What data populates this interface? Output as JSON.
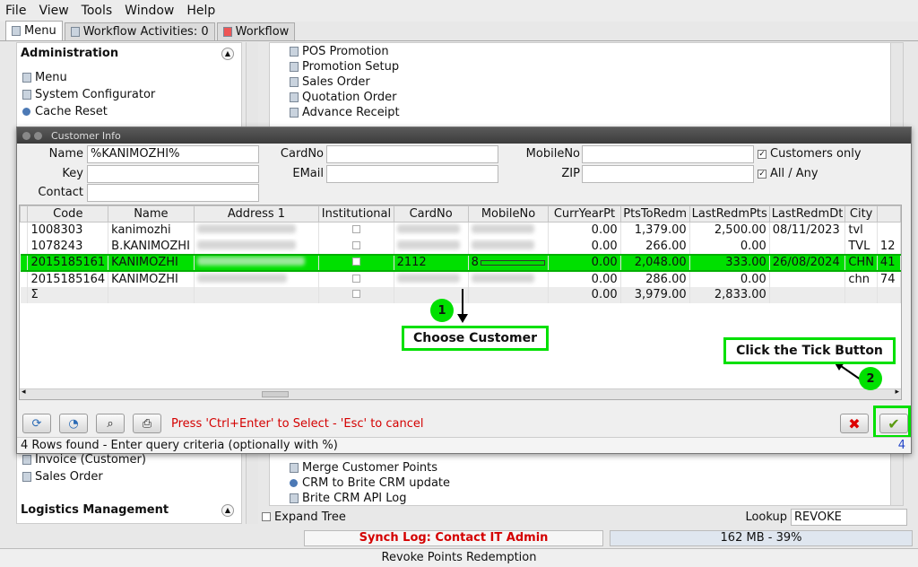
{
  "menubar": {
    "items": [
      "File",
      "View",
      "Tools",
      "Window",
      "Help"
    ]
  },
  "tabs": [
    {
      "label": "Menu"
    },
    {
      "label": "Workflow Activities: 0"
    },
    {
      "label": "Workflow"
    }
  ],
  "left_panel": {
    "admin_title": "Administration",
    "admin_items": [
      "Menu",
      "System Configurator",
      "Cache Reset"
    ],
    "lower_items": [
      "Invoice (Customer)",
      "Sales Order"
    ],
    "logistics_title": "Logistics Management"
  },
  "right_panel": {
    "top_items": [
      "POS Promotion",
      "Promotion Setup",
      "Sales Order",
      "Quotation Order",
      "Advance Receipt"
    ],
    "bottom_items": [
      "Merge Customer Points",
      "CRM to Brite CRM update",
      "Brite CRM API Log"
    ],
    "expand_tree": "Expand Tree",
    "lookup_label": "Lookup",
    "lookup_value": "REVOKE"
  },
  "dialog": {
    "title": "Customer Info",
    "fields": {
      "name_label": "Name",
      "name_value": "%KANIMOZHI%",
      "key_label": "Key",
      "contact_label": "Contact",
      "cardno_label": "CardNo",
      "email_label": "EMail",
      "mobile_label": "MobileNo",
      "zip_label": "ZIP",
      "customers_only": "Customers only",
      "all_any": "All / Any"
    },
    "columns": [
      "Code",
      "Name",
      "Address 1",
      "Institutional",
      "CardNo",
      "MobileNo",
      "CurrYearPt",
      "PtsToRedm",
      "LastRedmPts",
      "LastRedmDt",
      "City"
    ],
    "rows": [
      {
        "code": "1008303",
        "name": "kanimozhi",
        "cardno": "",
        "mobile": "",
        "curr": "0.00",
        "pts": "1,379.00",
        "last": "2,500.00",
        "date": "08/11/2023",
        "city": "tvl",
        "extra": ""
      },
      {
        "code": "1078243",
        "name": "B.KANIMOZHI",
        "cardno": "",
        "mobile": "",
        "curr": "0.00",
        "pts": "266.00",
        "last": "0.00",
        "date": "",
        "city": "TVL",
        "extra": "12"
      },
      {
        "code": "2015185161",
        "name": "KANIMOZHI",
        "cardno": "2112",
        "mobile": "8",
        "curr": "0.00",
        "pts": "2,048.00",
        "last": "333.00",
        "date": "26/08/2024",
        "city": "CHN",
        "extra": "41"
      },
      {
        "code": "2015185164",
        "name": "KANIMOZHI",
        "cardno": "",
        "mobile": "",
        "curr": "0.00",
        "pts": "286.00",
        "last": "0.00",
        "date": "",
        "city": "chn",
        "extra": "74"
      }
    ],
    "total": {
      "sigma": "Σ",
      "curr": "0.00",
      "pts": "3,979.00",
      "last": "2,833.00"
    },
    "hint": "Press 'Ctrl+Enter' to Select - 'Esc' to cancel",
    "status": "4 Rows found - Enter query criteria (optionally with %)",
    "status_count": "4"
  },
  "annotations": {
    "step1": "1",
    "choose": "Choose Customer",
    "step2": "2",
    "tick": "Click the Tick Button"
  },
  "statusbar": {
    "synch": "Synch Log: Contact IT Admin",
    "memory": "162 MB - 39%",
    "window_title": "Revoke Points Redemption"
  },
  "colors": {
    "highlight": "#00e000",
    "hint_red": "#d40000"
  }
}
